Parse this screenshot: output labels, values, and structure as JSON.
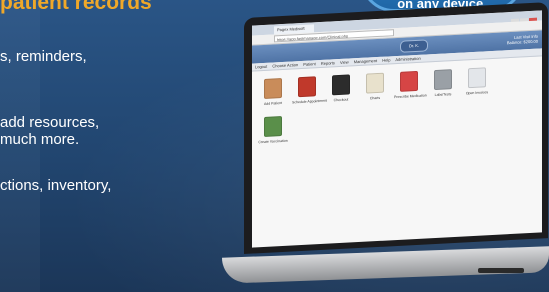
{
  "banner": {
    "heading": "patient records",
    "bullets": [
      "s, reminders,",
      "add resources,",
      "much more.",
      "ctions, inventory,"
    ],
    "badge_text": "on any device."
  },
  "browser": {
    "tab_title": "Pagex Medisoft",
    "url": "https://app.fastmanage.com/Clinical.php",
    "header_pill": "Dr. K.",
    "header_info": "Last Visit Info\nBalance: $200.00",
    "menu": [
      "Logout",
      "Choose Action",
      "Patient",
      "Reports",
      "View",
      "Management",
      "Help",
      "Administration"
    ]
  },
  "tiles": [
    {
      "label": "Add Patient",
      "icon": "person-icon",
      "color": "#c98c5a"
    },
    {
      "label": "Schedule Appointment",
      "icon": "calendar-icon",
      "color": "#c0392b"
    },
    {
      "label": "Checkout",
      "icon": "monitor-icon",
      "color": "#2c2c2c"
    },
    {
      "label": "Charts",
      "icon": "clipboard-icon",
      "color": "#e8e1cc"
    },
    {
      "label": "Prescribe Medication",
      "icon": "pill-icon",
      "color": "#d64545"
    },
    {
      "label": "Labs/Tests",
      "icon": "microscope-icon",
      "color": "#9aa0a6"
    },
    {
      "label": "Open Invoices",
      "icon": "invoice-icon",
      "color": "#e3e6ea"
    },
    {
      "label": "Create Vaccination",
      "icon": "people-icon",
      "color": "#5a8f4a"
    }
  ]
}
